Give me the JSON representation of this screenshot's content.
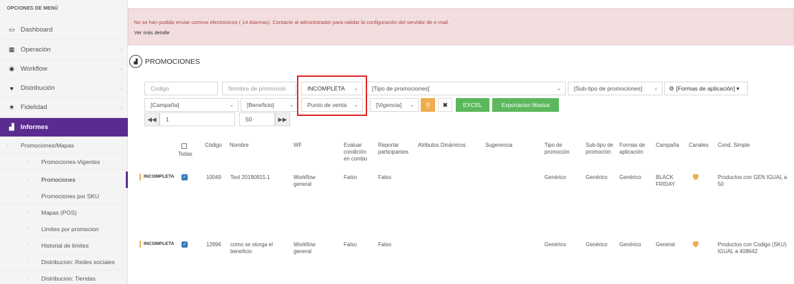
{
  "sidebar": {
    "header": "OPCIONES DE MENÚ",
    "items": [
      {
        "label": "Dashboard",
        "icon": "laptop-icon"
      },
      {
        "label": "Operación",
        "icon": "grid-icon"
      },
      {
        "label": "Workflow",
        "icon": "compass-icon"
      },
      {
        "label": "Distribución",
        "icon": "map-marker-icon"
      },
      {
        "label": "Fidelidad",
        "icon": "star-icon"
      },
      {
        "label": "Informes",
        "icon": "bar-chart-icon"
      }
    ],
    "sub": [
      {
        "label": "Promociones/Mapas"
      },
      {
        "label": "Promociones-Vigentes"
      },
      {
        "label": "Promociones"
      },
      {
        "label": "Promociones por SKU"
      },
      {
        "label": "Mapas (POS)"
      },
      {
        "label": "Limites por promocion"
      },
      {
        "label": "Historial de limites"
      },
      {
        "label": "Distribucion: Redes sociales"
      },
      {
        "label": "Distribucion: Tiendas"
      }
    ]
  },
  "alert": {
    "message": "No se han podido enviar correos electrónicos ( 14 Alarmas). Contacte al administrador para validar la configuración del servidor de e-mail.",
    "more": "Ver más detalle"
  },
  "page": {
    "title": "PROMOCIONES"
  },
  "filters": {
    "codigo_placeholder": "Codigo",
    "nombre_placeholder": "Nombre de promocion",
    "estado": "INCOMPLETA",
    "tipo": "[Tipo de promociones]",
    "subtipo": "[Sub-tipo de promociones]",
    "formas": "[Formas de aplicación]",
    "campana": "[Campaña]",
    "beneficio": "[Beneficio]",
    "punto_venta": "Punto de venta",
    "vigencia": "[Vigencia]",
    "excel": "EXCEL",
    "export": "Exportacion Masiva"
  },
  "pagination": {
    "page": "1",
    "page_size": "50"
  },
  "table": {
    "headers": {
      "todas": "Todas",
      "codigo": "Código",
      "nombre": "Nombre",
      "wf": "WF",
      "evaluar": "Evaluar condición en combo",
      "reportar": "Reportar participantes",
      "atributos": "Atributos Dinámicos",
      "sugerencia": "Sugerencia",
      "tipo": "Tipo de promoción",
      "subtipo": "Sub-tipo de promoción",
      "formas": "Formas de aplicación",
      "campana": "Campaña",
      "canales": "Canales",
      "cond": "Cond. Simple"
    },
    "rows": [
      {
        "status": "INCOMPLETA",
        "codigo": "10049",
        "nombre": "Test 20190815.1",
        "wf": "Workflow general",
        "evaluar": "Falso",
        "reportar": "Falso",
        "tipo": "Genérico",
        "subtipo": "Genérico",
        "formas": "Genérico",
        "campana": "BLACK FRIDAY",
        "cond": "Productos con GEN IGUAL a 50"
      },
      {
        "status": "INCOMPLETA",
        "codigo": "12996",
        "nombre": "como se otorga el beneficio",
        "wf": "Workflow general",
        "evaluar": "Falso",
        "reportar": "Falso",
        "tipo": "Genérico",
        "subtipo": "Genérico",
        "formas": "Genérico",
        "campana": "General",
        "cond": "Productos con Codigo (SKU) IGUAL a 408642"
      }
    ]
  },
  "colors": {
    "accent": "#5b2c8f",
    "alert_bg": "#f2dede",
    "alert_text": "#a94442",
    "search": "#f0ad4e",
    "green": "#5cb85c",
    "highlight": "#e02424"
  }
}
